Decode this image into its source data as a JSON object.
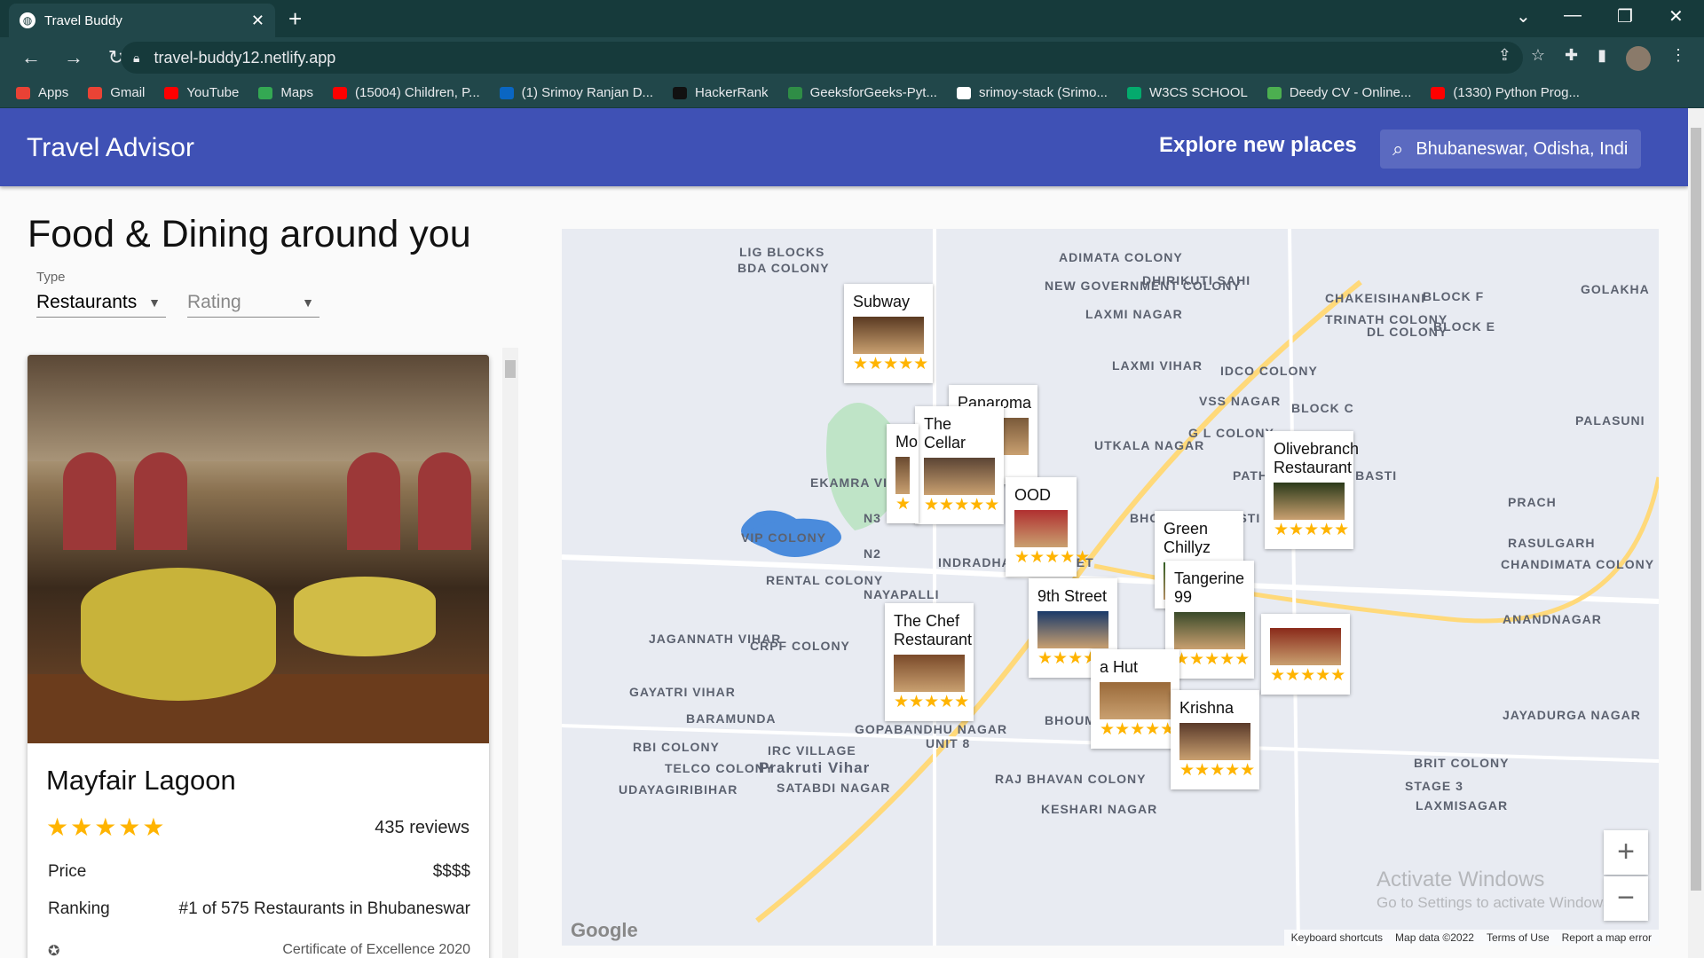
{
  "browser": {
    "tab_title": "Travel Buddy",
    "tab_close": "✕",
    "new_tab": "+",
    "url": "travel-buddy12.netlify.app",
    "bookmarks": [
      {
        "label": "Apps",
        "color": "#e94235"
      },
      {
        "label": "Gmail",
        "color": "#ea4335"
      },
      {
        "label": "YouTube",
        "color": "#ff0000"
      },
      {
        "label": "Maps",
        "color": "#34a853"
      },
      {
        "label": "(15004) Children, P...",
        "color": "#ff0000"
      },
      {
        "label": "(1) Srimoy Ranjan D...",
        "color": "#0a66c2"
      },
      {
        "label": "HackerRank",
        "color": "#111111"
      },
      {
        "label": "GeeksforGeeks-Pyt...",
        "color": "#2f8d46"
      },
      {
        "label": "srimoy-stack (Srimo...",
        "color": "#ffffff"
      },
      {
        "label": "W3CS SCHOOL",
        "color": "#04aa6d"
      },
      {
        "label": "Deedy CV - Online...",
        "color": "#4caf50"
      },
      {
        "label": "(1330) Python Prog...",
        "color": "#ff0000"
      }
    ]
  },
  "app": {
    "title": "Travel Advisor",
    "explore": "Explore new places",
    "search_value": "Bhubaneswar, Odisha, India"
  },
  "list": {
    "heading": "Food & Dining around you",
    "type_label": "Type",
    "type_value": "Restaurants",
    "rating_placeholder": "Rating"
  },
  "card": {
    "name": "Mayfair Lagoon",
    "stars": "★★★★★",
    "reviews": "435 reviews",
    "price_label": "Price",
    "price_value": "$$$$",
    "ranking_label": "Ranking",
    "ranking_value": "#1 of 575 Restaurants in Bhubaneswar",
    "award": "Certificate of Excellence 2020"
  },
  "map": {
    "labels": [
      "LIG BLOCKS",
      "BDA COLONY",
      "ADIMATA COLONY",
      "DHIRIKUTI SAHI",
      "GOLAKHA",
      "NEW GOVERNMENT COLONY",
      "BLOCK F",
      "CHAKEISIHANI",
      "TRINATH COLONY",
      "LAXMI NAGAR",
      "DL COLONY",
      "BLOCK E",
      "LAXMI VIHAR",
      "IDCO COLONY",
      "VSS NAGAR",
      "BLOCK C",
      "PALASUNI",
      "G L COLONY",
      "UTKALA NAGAR",
      "PATHAR BANDHA BASTI",
      "PRACH",
      "EKAMRA VIHAR",
      "N3",
      "BHOINAGAR BASTI",
      "VIP COLONY",
      "N2",
      "RASULGARH",
      "CHANDIMATA COLONY",
      "RENTAL COLONY",
      "NAYAPALLI",
      "INDRADHANU MARKET",
      "JAGANNATH VIHAR",
      "CRPF COLONY",
      "ANANDNAGAR",
      "GAYATRI VIHAR",
      "BARAMUNDA",
      "GOPABANDHU NAGAR",
      "UNIT 8",
      "BHOUMA",
      "JAYADURGA NAGAR",
      "RBI COLONY",
      "IRC VILLAGE",
      "TELCO COLONY",
      "Prakruti Vihar",
      "RAJ BHAVAN COLONY",
      "BRIT COLONY",
      "UDAYAGIRIBIHAR",
      "SATABDI NAGAR",
      "KESHARI NAGAR",
      "STAGE 3",
      "LAXMISAGAR"
    ],
    "pins": [
      {
        "name": "Subway",
        "stars": "★★★★★"
      },
      {
        "name": "Panaroma",
        "stars": "★"
      },
      {
        "name": "The Cellar",
        "stars": "★★★★★"
      },
      {
        "name": "Mo",
        "stars": "★"
      },
      {
        "name": "OOD",
        "stars": "★★★★★"
      },
      {
        "name": "Olivebranch Restaurant",
        "stars": "★★★★★"
      },
      {
        "name": "Green Chillyz",
        "stars": ""
      },
      {
        "name": "Tangerine 99",
        "stars": "★★★★★"
      },
      {
        "name": "9th Street",
        "stars": "★★★★★"
      },
      {
        "name": "The Chef Restaurant",
        "stars": "★★★★★"
      },
      {
        "name": "a Hut",
        "stars": "★★★★★"
      },
      {
        "name": "Krishna",
        "stars": "★★★★★"
      },
      {
        "name": "",
        "stars": "★★★★★"
      }
    ],
    "zoom_in": "+",
    "zoom_out": "−",
    "google": "Google",
    "footer": [
      "Keyboard shortcuts",
      "Map data ©2022",
      "Terms of Use",
      "Report a map error"
    ],
    "watermark": "Activate Windows",
    "watermark_sub": "Go to Settings to activate Windows."
  }
}
